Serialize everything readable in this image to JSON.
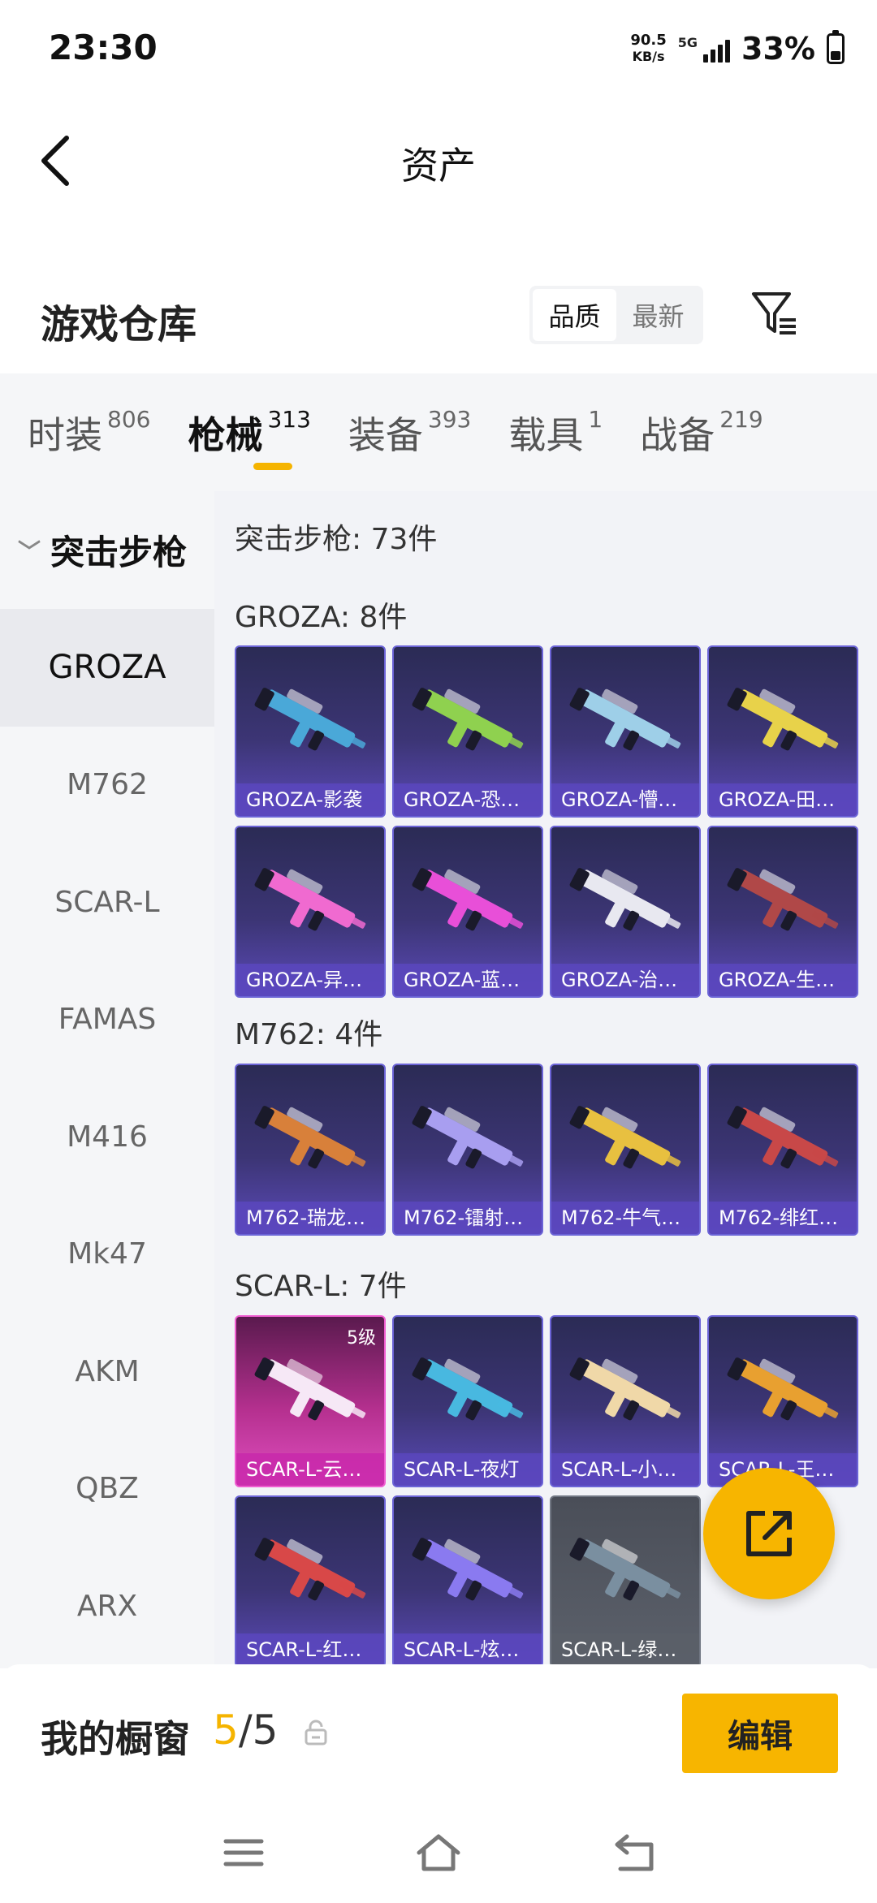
{
  "status": {
    "time": "23:30",
    "net_speed_value": "90.5",
    "net_speed_unit": "KB/s",
    "network": "5G",
    "battery": "33%"
  },
  "header": {
    "title": "资产"
  },
  "warehouse": {
    "title": "游戏仓库",
    "sort_options": [
      "品质",
      "最新"
    ],
    "sort_selected": "品质"
  },
  "category_tabs": [
    {
      "name": "时装",
      "count": "806"
    },
    {
      "name": "枪械",
      "count": "313"
    },
    {
      "name": "装备",
      "count": "393"
    },
    {
      "name": "载具",
      "count": "1"
    },
    {
      "name": "战备",
      "count": "219"
    }
  ],
  "active_tab": "枪械",
  "sidebar": {
    "group": "突击步枪",
    "items": [
      "GROZA",
      "M762",
      "SCAR-L",
      "FAMAS",
      "M416",
      "Mk47",
      "AKM",
      "QBZ",
      "ARX"
    ],
    "selected": "GROZA"
  },
  "content": {
    "total": "突击步枪: 73件",
    "groups": [
      {
        "title": "GROZA: 8件",
        "items": [
          {
            "label": "GROZA-影袭",
            "accent": "#4aa8d8"
          },
          {
            "label": "GROZA-恐…",
            "accent": "#8fd14f"
          },
          {
            "label": "GROZA-懵…",
            "accent": "#9ecfe8"
          },
          {
            "label": "GROZA-田…",
            "accent": "#e8d24a"
          },
          {
            "label": "GROZA-异…",
            "accent": "#f06ad0"
          },
          {
            "label": "GROZA-蓝…",
            "accent": "#e84fd8"
          },
          {
            "label": "GROZA-治…",
            "accent": "#e8e8f0"
          },
          {
            "label": "GROZA-生…",
            "accent": "#b04848"
          }
        ]
      },
      {
        "title": "M762: 4件",
        "items": [
          {
            "label": "M762-瑞龙…",
            "accent": "#d8803a"
          },
          {
            "label": "M762-镭射…",
            "accent": "#a89ef0"
          },
          {
            "label": "M762-牛气…",
            "accent": "#e8c040"
          },
          {
            "label": "M762-绯红…",
            "accent": "#c84848"
          }
        ]
      },
      {
        "title": "SCAR-L: 7件",
        "items": [
          {
            "label": "SCAR-L-云…",
            "accent": "#f6e8f6",
            "level": "5级",
            "rare": true
          },
          {
            "label": "SCAR-L-夜灯",
            "accent": "#48b8e0"
          },
          {
            "label": "SCAR-L-小…",
            "accent": "#f0d8a8"
          },
          {
            "label": "SCAR-L-王…",
            "accent": "#e8a030"
          },
          {
            "label": "SCAR-L-红…",
            "accent": "#d84848"
          },
          {
            "label": "SCAR-L-炫…",
            "accent": "#8a7af0"
          },
          {
            "label": "SCAR-L-绿…",
            "accent": "#7a8fa0",
            "grey": true
          }
        ]
      }
    ]
  },
  "showcase": {
    "label": "我的橱窗",
    "current": "5",
    "separator": "/",
    "max": "5",
    "edit_label": "编辑"
  }
}
